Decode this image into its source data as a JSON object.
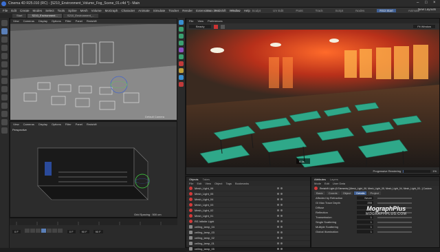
{
  "window": {
    "title": "Cinema 4D R25.010 (RC) - [S210_Environment_Volume_Fog_Scene_01.c4d *] - Main",
    "controls": [
      "–",
      "□",
      "×"
    ]
  },
  "menu": [
    "File",
    "Edit",
    "Create",
    "Modes",
    "Select",
    "Tools",
    "Spline",
    "Mesh",
    "Volume",
    "MoGraph",
    "Character",
    "Animate",
    "Simulate",
    "Tracker",
    "Render",
    "Extensions",
    "Redshift",
    "Window",
    "Help"
  ],
  "layouts": {
    "items": [
      "Standard",
      "Model",
      "Sculpt",
      "UV Edit",
      "Paint",
      "Track",
      "Script",
      "Nodes",
      "RS3 Start",
      "Animate"
    ],
    "active_index": 8,
    "new_layouts": "New Layouts"
  },
  "doc_tabs": [
    "Start",
    "S210_Environment...",
    "S210_Environment_..."
  ],
  "viewport_top": {
    "menu": [
      "View",
      "Cameras",
      "Display",
      "Options",
      "Filter",
      "Panel",
      "Redshift"
    ],
    "label": "Perspective",
    "camera": "Default Camera"
  },
  "viewport_bottom": {
    "menu": [
      "View",
      "Cameras",
      "Display",
      "Options",
      "Filter",
      "Panel",
      "Redshift"
    ],
    "label": "Perspective",
    "grid": "Grid Spacing : 500 cm"
  },
  "render_view": {
    "menu": [
      "File",
      "View",
      "Preferences"
    ],
    "mode": "Beauty",
    "progress_label": "Progressive Rendering",
    "progress_value": "1%",
    "time": "4.1s",
    "zoom": "Fit Window"
  },
  "objects": {
    "menu": [
      "File",
      "Edit",
      "View",
      "Object",
      "Tags",
      "Bookmarks"
    ],
    "tabs": [
      "Objects",
      "Takes"
    ],
    "rows": [
      {
        "name": "Mesh_Light_06",
        "type": "light"
      },
      {
        "name": "Mesh_Light_05",
        "type": "light"
      },
      {
        "name": "Mesh_Light_04",
        "type": "light"
      },
      {
        "name": "Mesh_Light_03",
        "type": "light"
      },
      {
        "name": "Mesh_Light_02",
        "type": "light"
      },
      {
        "name": "Mesh_Light_01",
        "type": "light"
      },
      {
        "name": "RS Infinite Light",
        "type": "light"
      },
      {
        "name": "ceiling_lamp_04",
        "type": "mesh"
      },
      {
        "name": "ceiling_lamp_03",
        "type": "mesh"
      },
      {
        "name": "ceiling_lamp_02",
        "type": "mesh"
      },
      {
        "name": "ceiling_lamp_01",
        "type": "mesh"
      },
      {
        "name": "ceiling_lamp_05",
        "type": "mesh"
      }
    ]
  },
  "attributes": {
    "tabs": [
      "Attributes",
      "Layers"
    ],
    "menu": [
      "Mode",
      "Edit",
      "User Data"
    ],
    "header": "Redshift Light (6 Elements) [Mesh_Light_06, Mesh_Light_05, Mesh_Light_04, Mesh_Light_03...] Custom",
    "sub_tabs": [
      "Basic",
      "Coords",
      "Object",
      "Details",
      "Project"
    ],
    "rows": [
      {
        "label": "Affected by Refraction",
        "value": "Never"
      },
      {
        "label": "GI Max Trace Depth",
        "value": "255"
      },
      {
        "label": "Diffuse",
        "value": "1"
      },
      {
        "label": "Reflection",
        "value": "1"
      },
      {
        "label": "Transmission",
        "value": "1"
      },
      {
        "label": "Single Scattering",
        "value": "1"
      },
      {
        "label": "Multiple Scattering",
        "value": "1"
      },
      {
        "label": "Global Illumination",
        "value": "1"
      }
    ]
  },
  "timeline": {
    "frame": "0 F",
    "start": "0 F",
    "end": "90 F",
    "end2": "90 F"
  },
  "watermark": {
    "brand": "MographPlus",
    "url": "MOGRAPHPLUS.COM"
  },
  "colors": {
    "accent": "#3f5f93",
    "light_icon": "#d43a3a",
    "render_red": "#e0421c",
    "render_green": "#2fa889"
  }
}
